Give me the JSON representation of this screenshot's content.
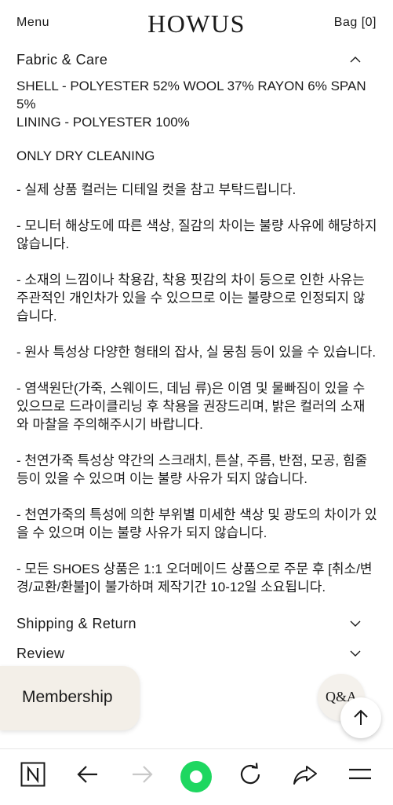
{
  "header": {
    "menu_label": "Menu",
    "logo_text": "HOWUS",
    "bag_label": "Bag [0]"
  },
  "sections": {
    "fabric": {
      "title": "Fabric & Care",
      "expanded": true
    },
    "shipping": {
      "title": "Shipping & Return",
      "expanded": false
    },
    "review": {
      "title": "Review",
      "expanded": false
    }
  },
  "fabric_care": {
    "shell": "SHELL - POLYESTER 52% WOOL 37% RAYON 6% SPAN 5%",
    "lining": "LINING - POLYESTER 100%",
    "cleaning": "ONLY DRY CLEANING",
    "notes": [
      "- 실제 상품 컬러는 디테일 컷을 참고 부탁드립니다.",
      "- 모니터 해상도에 따른 색상, 질감의 차이는 불량 사유에 해당하지 않습니다.",
      "- 소재의 느낌이나 착용감, 착용 핏감의 차이 등으로 인한 사유는 주관적인 개인차가 있을 수 있으므로 이는 불량으로 인정되지 않습니다.",
      "- 원사 특성상 다양한 형태의 잡사, 실 뭉침 등이 있을 수 있습니다.",
      "- 염색원단(가죽, 스웨이드, 데님 류)은 이염 및 물빠짐이 있을 수 있으므로 드라이클리닝 후 착용을 권장드리며, 밝은 컬러의 소재와 마찰을 주의해주시기 바랍니다.",
      "- 천연가죽 특성상 약간의 스크래치, 튼살, 주름, 반점, 모공, 힘줄 등이 있을 수 있으며 이는 불량 사유가 되지 않습니다.",
      "- 천연가죽의 특성에 의한 부위별 미세한 색상 및 광도의 차이가 있을 수 있으며 이는 불량 사유가 되지 않습니다.",
      "- 모든 SHOES 상품은 1:1 오더메이드 상품으로 주문 후 [취소/변경/교환/환불]이 불가하며 제작기간 10-12일 소요됩니다."
    ]
  },
  "floating": {
    "membership_label": "Membership",
    "qa_label": "Q&A"
  },
  "bottom_nav": {
    "icons": [
      "app-logo-icon",
      "back-arrow-icon",
      "forward-arrow-icon",
      "home-dot-icon",
      "refresh-icon",
      "share-icon",
      "hamburger-menu-icon"
    ],
    "accent_color": "#1ed760"
  },
  "colors": {
    "text": "#1a1a1a",
    "membership_bg": "#f3efe8"
  }
}
